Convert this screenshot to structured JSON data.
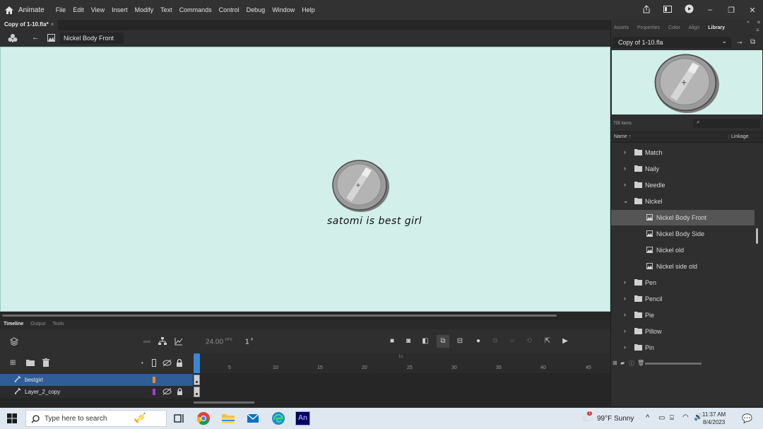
{
  "app": {
    "name": "Animate",
    "menus": [
      "File",
      "Edit",
      "View",
      "Insert",
      "Modify",
      "Text",
      "Commands",
      "Control",
      "Debug",
      "Window",
      "Help"
    ]
  },
  "document": {
    "tab_title": "Copy of 1-10.fla*",
    "tab_close": "×",
    "scene_symbol": "Nickel Body Front"
  },
  "stage": {
    "background": "#d2efea",
    "text_on_stage": "satomi is best girl"
  },
  "timeline": {
    "tabs": [
      "Timeline",
      "Output",
      "Tools"
    ],
    "active_tab": "Timeline",
    "fps": "24.00",
    "fps_unit": "FPS",
    "current_frame": "1",
    "frame_unit": "F",
    "ruler_second_label": "1s",
    "ruler_numbers": [
      "5",
      "10",
      "15",
      "20",
      "25",
      "30",
      "35",
      "40",
      "45"
    ],
    "layers": [
      {
        "name": "bestgirl",
        "color": "#f08a24",
        "selected": true
      },
      {
        "name": "Layer_2_copy",
        "color": "#9a3fd6",
        "selected": false
      }
    ]
  },
  "panel": {
    "tabs": [
      "Assets",
      "Properties",
      "Color",
      "Align",
      "Library"
    ],
    "active_tab": "Library",
    "library_file": "Copy of 1-10.fla",
    "item_count": "755 items",
    "columns": {
      "name": "Name",
      "linkage": "Linkage"
    },
    "tree": [
      {
        "label": "Match",
        "type": "folder",
        "expanded": false,
        "level": 0,
        "selected": false
      },
      {
        "label": "Naily",
        "type": "folder",
        "expanded": false,
        "level": 0,
        "selected": false
      },
      {
        "label": "Needle",
        "type": "folder",
        "expanded": false,
        "level": 0,
        "selected": false
      },
      {
        "label": "Nickel",
        "type": "folder",
        "expanded": true,
        "level": 0,
        "selected": false
      },
      {
        "label": "Nickel Body Front",
        "type": "symbol",
        "level": 1,
        "selected": true
      },
      {
        "label": "Nickel Body Side",
        "type": "symbol",
        "level": 1,
        "selected": false
      },
      {
        "label": "Nickel old",
        "type": "symbol",
        "level": 1,
        "selected": false
      },
      {
        "label": "Nickel side old",
        "type": "symbol",
        "level": 1,
        "selected": false
      },
      {
        "label": "Pen",
        "type": "folder",
        "expanded": false,
        "level": 0,
        "selected": false
      },
      {
        "label": "Pencil",
        "type": "folder",
        "expanded": false,
        "level": 0,
        "selected": false
      },
      {
        "label": "Pie",
        "type": "folder",
        "expanded": false,
        "level": 0,
        "selected": false
      },
      {
        "label": "Pillow",
        "type": "folder",
        "expanded": false,
        "level": 0,
        "selected": false
      },
      {
        "label": "Pin",
        "type": "folder",
        "expanded": false,
        "level": 0,
        "selected": false
      }
    ]
  },
  "taskbar": {
    "search_placeholder": "Type here to search",
    "weather": "99°F  Sunny",
    "weather_badge": "1",
    "time": "11:37 AM",
    "date": "8/4/2023"
  }
}
